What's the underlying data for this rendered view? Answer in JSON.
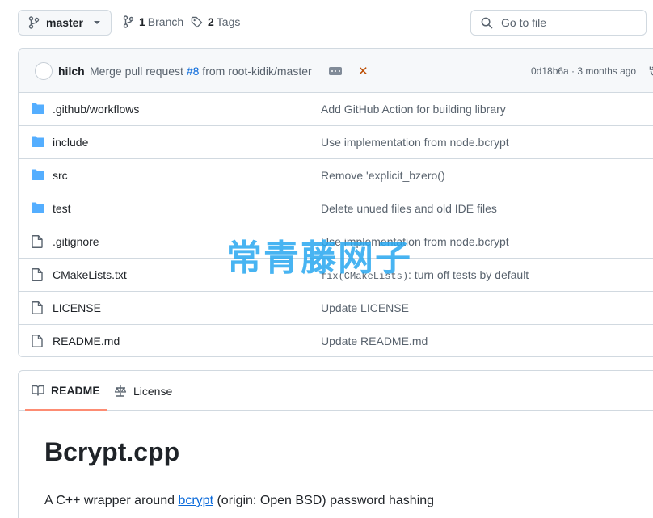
{
  "branch": {
    "name": "master"
  },
  "branches": {
    "count": "1",
    "label": "Branch"
  },
  "tags": {
    "count": "2",
    "label": "Tags"
  },
  "search": {
    "placeholder": "Go to file"
  },
  "commit": {
    "author": "hilch",
    "message_prefix": "Merge pull request ",
    "pr_link": "#8",
    "message_suffix": " from root-kidik/master",
    "hash": "0d18b6a",
    "time": " · 3 months ago",
    "status_color": "#bc4c00"
  },
  "files": [
    {
      "type": "folder",
      "name": ".github/workflows",
      "message": "Add GitHub Action for building library"
    },
    {
      "type": "folder",
      "name": "include",
      "message": "Use implementation from node.bcrypt"
    },
    {
      "type": "folder",
      "name": "src",
      "message": "Remove 'explicit_bzero()"
    },
    {
      "type": "folder",
      "name": "test",
      "message": "Delete unued files and old IDE files"
    },
    {
      "type": "file",
      "name": ".gitignore",
      "message": "Use implementation from node.bcrypt"
    },
    {
      "type": "file",
      "name": "CMakeLists.txt",
      "message_code": "fix(CMakeLists)",
      "message_rest": ": turn off tests by default"
    },
    {
      "type": "file",
      "name": "LICENSE",
      "message": "Update LICENSE"
    },
    {
      "type": "file",
      "name": "README.md",
      "message": "Update README.md"
    }
  ],
  "watermark": {
    "text": "常青藤网子"
  },
  "readme": {
    "tab_readme": "README",
    "tab_license": "License",
    "title": "Bcrypt.cpp",
    "desc_prefix": "A C++ wrapper around ",
    "desc_link": "bcrypt",
    "desc_suffix": " (origin: Open BSD) password hashing"
  },
  "colors": {
    "folder": "#54aeff",
    "link": "#0969da",
    "tab_underline": "#fd8c73"
  }
}
